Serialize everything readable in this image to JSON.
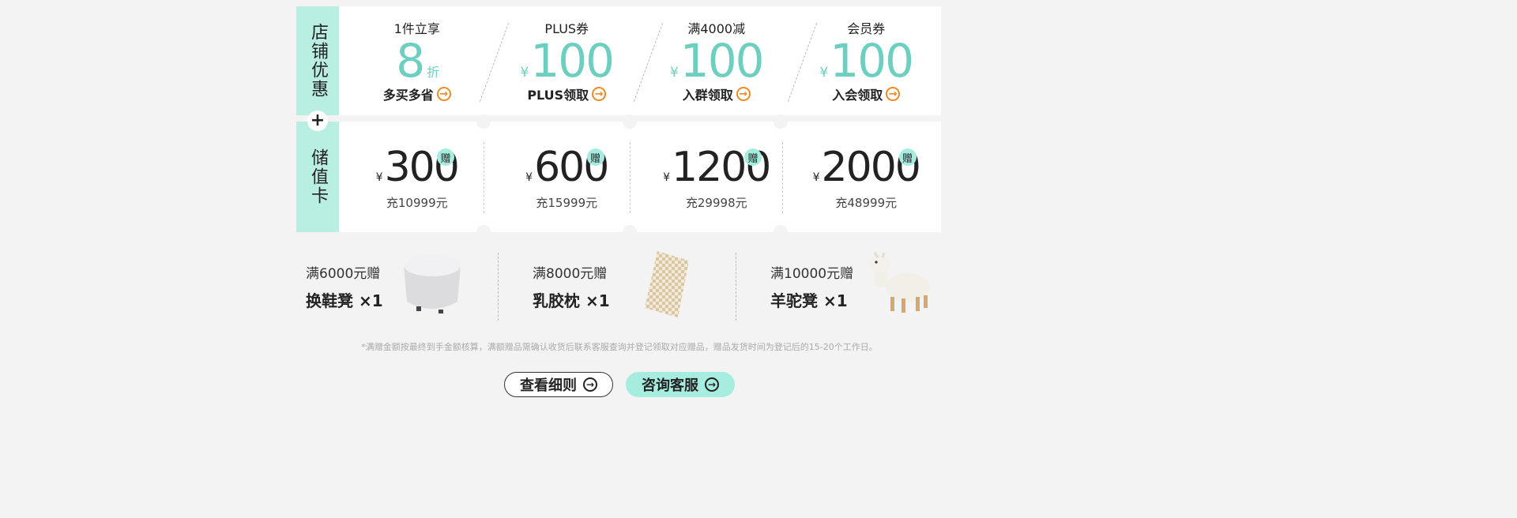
{
  "promo": {
    "store_label": "店铺优惠",
    "plus_sign": "+",
    "card_label": "储值卡",
    "coupons": [
      {
        "title": "1件立享",
        "yen": "",
        "value": "8",
        "suffix": "折",
        "action": "多买多省"
      },
      {
        "title": "PLUS券",
        "yen": "¥",
        "value": "100",
        "suffix": "",
        "action": "PLUS领取"
      },
      {
        "title": "满4000减",
        "yen": "¥",
        "value": "100",
        "suffix": "",
        "action": "入群领取"
      },
      {
        "title": "会员券",
        "yen": "¥",
        "value": "100",
        "suffix": "",
        "action": "入会领取"
      }
    ],
    "cards": [
      {
        "yen": "¥",
        "amount": "300",
        "gift": "赠",
        "condition": "充10999元"
      },
      {
        "yen": "¥",
        "amount": "600",
        "gift": "赠",
        "condition": "充15999元"
      },
      {
        "yen": "¥",
        "amount": "1200",
        "gift": "赠",
        "condition": "充29998元"
      },
      {
        "yen": "¥",
        "amount": "2000",
        "gift": "赠",
        "condition": "充48999元"
      }
    ],
    "gifts": [
      {
        "threshold": "满6000元赠",
        "item": "换鞋凳 ×1",
        "icon": "stool-image"
      },
      {
        "threshold": "满8000元赠",
        "item": "乳胶枕 ×1",
        "icon": "pillow-image"
      },
      {
        "threshold": "满10000元赠",
        "item": "羊驼凳 ×1",
        "icon": "alpaca-stool-image"
      }
    ],
    "note": "*满赠金额按最终到手金额核算，满额赠品需确认收货后联系客服查询并登记领取对应赠品，赠品发货时间为登记后的15-20个工作日。",
    "buttons": {
      "rules": "查看细则",
      "service": "咨询客服"
    },
    "colors": {
      "accent": "#6ccfbf",
      "mint": "#a6ede0",
      "orange": "#f08a24"
    }
  }
}
